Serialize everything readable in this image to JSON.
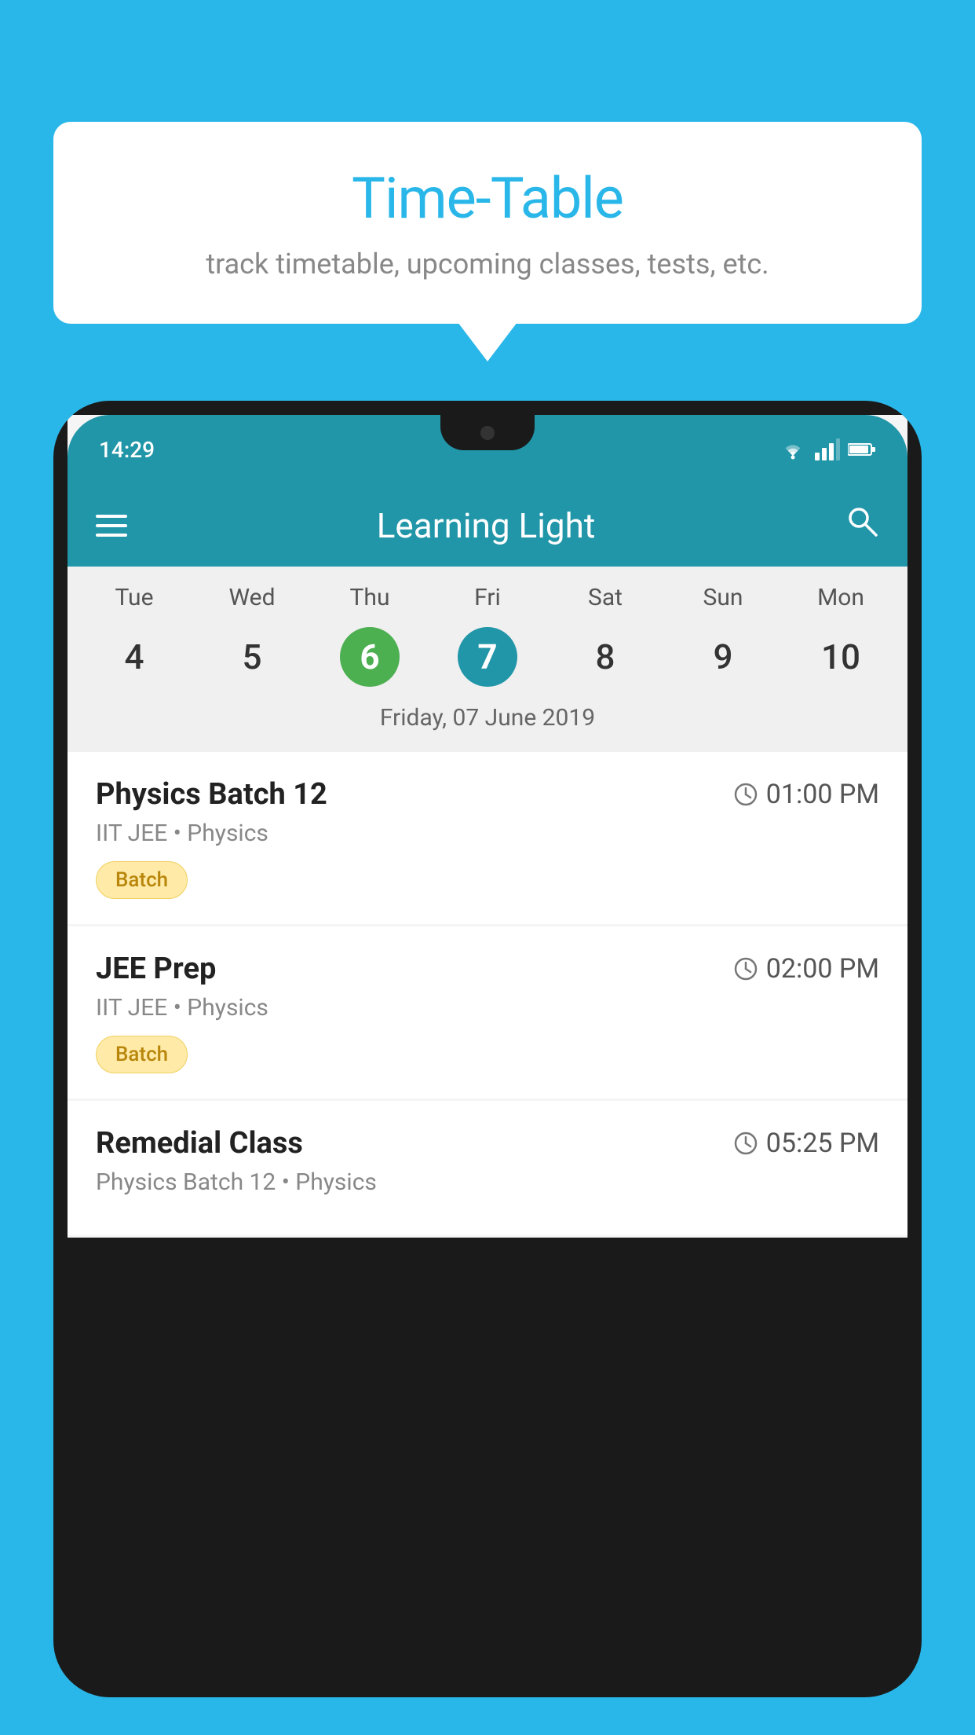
{
  "background": {
    "color": "#29b6e8"
  },
  "speechBubble": {
    "title": "Time-Table",
    "subtitle": "track timetable, upcoming classes, tests, etc."
  },
  "phone": {
    "statusBar": {
      "time": "14:29"
    },
    "appBar": {
      "title": "Learning Light"
    },
    "calendar": {
      "days": [
        "Tue",
        "Wed",
        "Thu",
        "Fri",
        "Sat",
        "Sun",
        "Mon"
      ],
      "dates": [
        "4",
        "5",
        "6",
        "7",
        "8",
        "9",
        "10"
      ],
      "todayIndex": 2,
      "selectedIndex": 3,
      "selectedDateLabel": "Friday, 07 June 2019"
    },
    "scheduleItems": [
      {
        "title": "Physics Batch 12",
        "time": "01:00 PM",
        "subtitle": "IIT JEE • Physics",
        "badge": "Batch"
      },
      {
        "title": "JEE Prep",
        "time": "02:00 PM",
        "subtitle": "IIT JEE • Physics",
        "badge": "Batch"
      },
      {
        "title": "Remedial Class",
        "time": "05:25 PM",
        "subtitle": "Physics Batch 12 • Physics",
        "badge": null
      }
    ]
  }
}
